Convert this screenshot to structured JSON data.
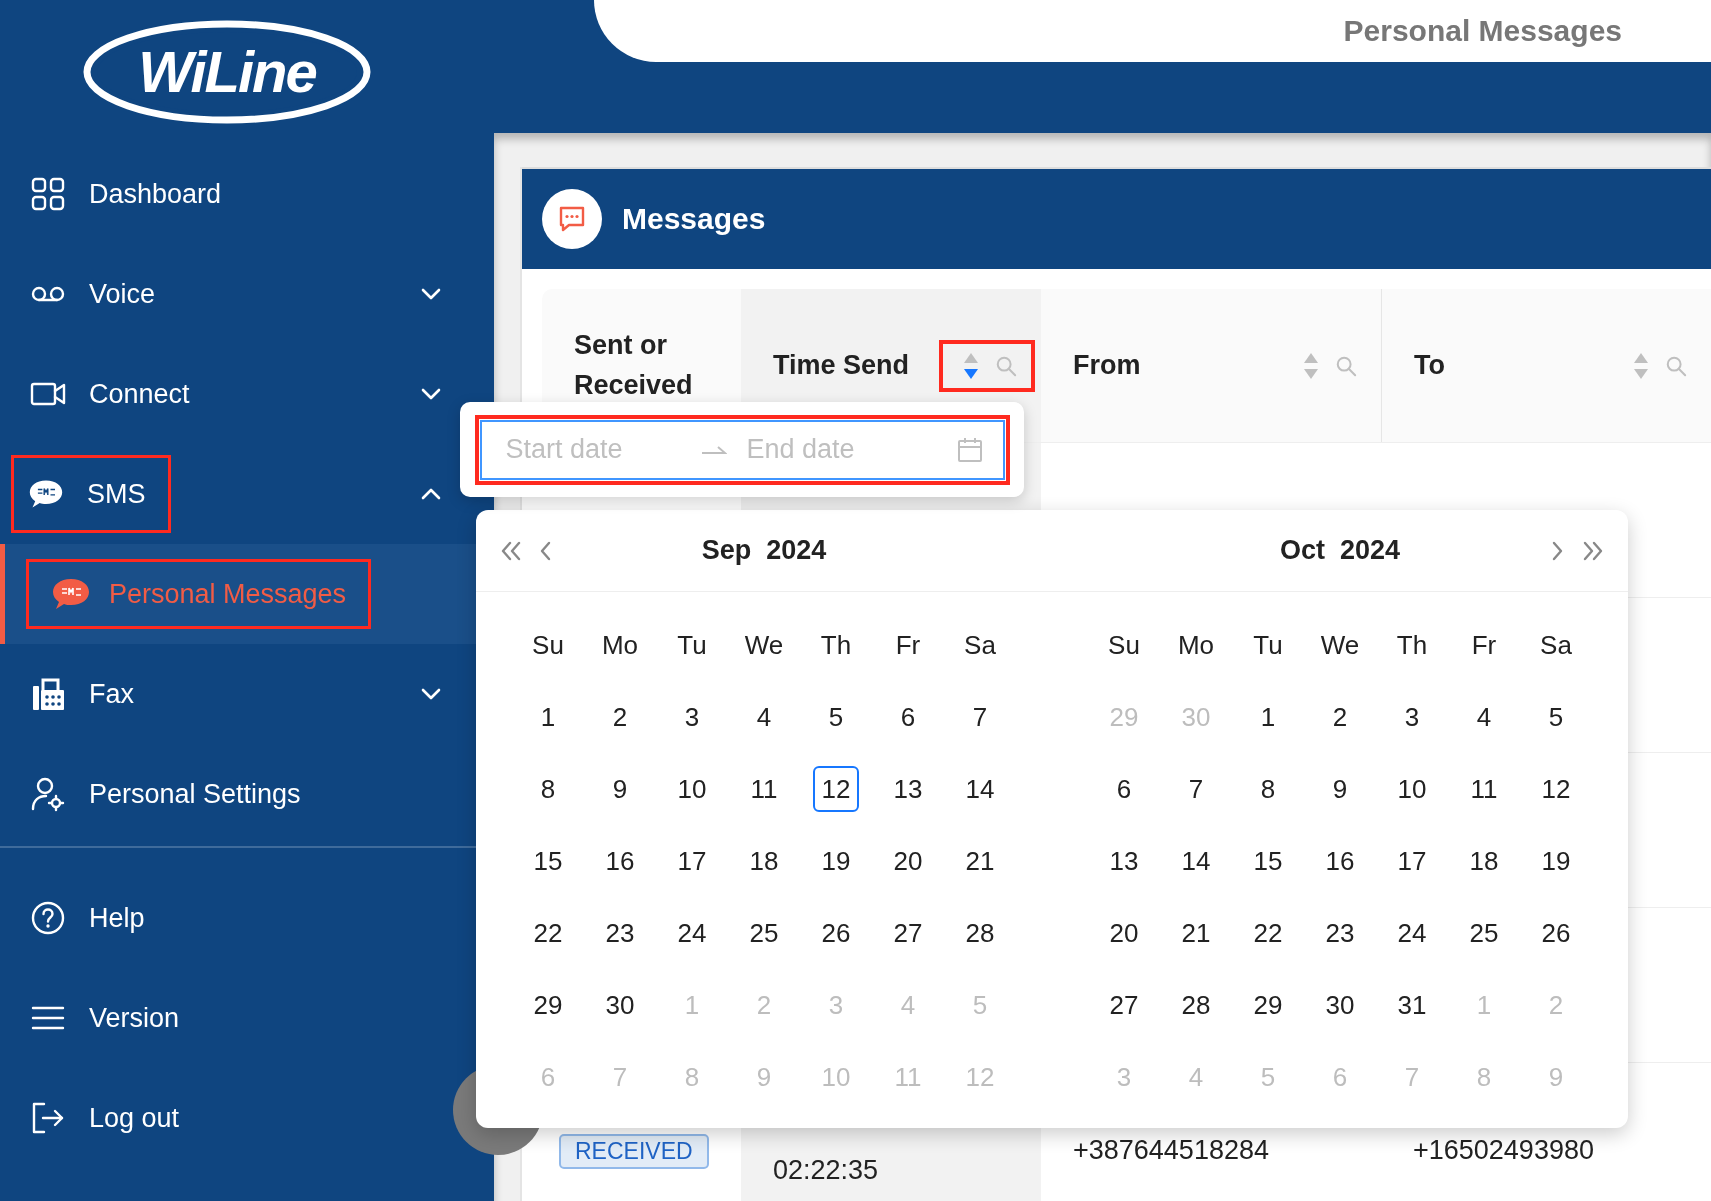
{
  "logo": "WiLine",
  "header": {
    "title": "Personal Messages"
  },
  "menu": [
    {
      "label": "Dashboard",
      "expandable": false,
      "highlighted": false
    },
    {
      "label": "Voice",
      "expandable": true,
      "expanded": false,
      "highlighted": false
    },
    {
      "label": "Connect",
      "expandable": true,
      "expanded": false,
      "highlighted": false
    },
    {
      "label": "SMS",
      "expandable": true,
      "expanded": true,
      "highlighted": true,
      "children": [
        {
          "label": "Personal Messages",
          "selected": true,
          "highlighted": true
        }
      ]
    },
    {
      "label": "Fax",
      "expandable": true,
      "expanded": false,
      "highlighted": false
    },
    {
      "label": "Personal Settings",
      "expandable": false,
      "highlighted": false
    }
  ],
  "bottom_menu": [
    {
      "label": "Help"
    },
    {
      "label": "Version"
    },
    {
      "label": "Log out"
    }
  ],
  "card": {
    "title": "Messages"
  },
  "table": {
    "columns": [
      {
        "label": "Sent or Received",
        "filterable": false,
        "sorted": false,
        "highlighted": false
      },
      {
        "label": "Time Send",
        "filterable": true,
        "sorted": true,
        "highlighted": true
      },
      {
        "label": "From",
        "filterable": true,
        "sorted": false,
        "highlighted": false
      },
      {
        "label": "To",
        "filterable": true,
        "sorted": false,
        "highlighted": false
      }
    ],
    "rows": [
      {
        "status": "RECEIVED",
        "time": "02:22:35",
        "from": "+387644518284",
        "to": "+16502493980"
      }
    ]
  },
  "date_range": {
    "start_placeholder": "Start date",
    "end_placeholder": "End date",
    "highlighted": true
  },
  "calendar": {
    "weekdays_left": [
      "Su",
      "Mo",
      "Tu",
      "We",
      "Th",
      "Fr",
      "Sa"
    ],
    "weekdays_right": [
      "Su",
      "Mo",
      "Tu",
      "We",
      "Th",
      "Fr",
      "Sa"
    ],
    "panels": [
      {
        "month": "Sep",
        "year": "2024",
        "weeks": [
          [
            {
              "t": "1",
              "kind": "normal"
            },
            {
              "t": "2",
              "kind": "normal"
            },
            {
              "t": "3",
              "kind": "normal"
            },
            {
              "t": "4",
              "kind": "normal"
            },
            {
              "t": "5",
              "kind": "normal"
            },
            {
              "t": "6",
              "kind": "normal"
            },
            {
              "t": "7",
              "kind": "normal"
            }
          ],
          [
            {
              "t": "8",
              "kind": "normal"
            },
            {
              "t": "9",
              "kind": "normal"
            },
            {
              "t": "10",
              "kind": "normal"
            },
            {
              "t": "11",
              "kind": "normal"
            },
            {
              "t": "12",
              "kind": "today"
            },
            {
              "t": "13",
              "kind": "normal"
            },
            {
              "t": "14",
              "kind": "normal"
            }
          ],
          [
            {
              "t": "15",
              "kind": "normal"
            },
            {
              "t": "16",
              "kind": "normal"
            },
            {
              "t": "17",
              "kind": "normal"
            },
            {
              "t": "18",
              "kind": "normal"
            },
            {
              "t": "19",
              "kind": "normal"
            },
            {
              "t": "20",
              "kind": "normal"
            },
            {
              "t": "21",
              "kind": "normal"
            }
          ],
          [
            {
              "t": "22",
              "kind": "normal"
            },
            {
              "t": "23",
              "kind": "normal"
            },
            {
              "t": "24",
              "kind": "normal"
            },
            {
              "t": "25",
              "kind": "normal"
            },
            {
              "t": "26",
              "kind": "normal"
            },
            {
              "t": "27",
              "kind": "normal"
            },
            {
              "t": "28",
              "kind": "normal"
            }
          ],
          [
            {
              "t": "29",
              "kind": "normal"
            },
            {
              "t": "30",
              "kind": "normal"
            },
            {
              "t": "1",
              "kind": "muted"
            },
            {
              "t": "2",
              "kind": "muted"
            },
            {
              "t": "3",
              "kind": "muted"
            },
            {
              "t": "4",
              "kind": "muted"
            },
            {
              "t": "5",
              "kind": "muted"
            }
          ],
          [
            {
              "t": "6",
              "kind": "muted"
            },
            {
              "t": "7",
              "kind": "muted"
            },
            {
              "t": "8",
              "kind": "muted"
            },
            {
              "t": "9",
              "kind": "muted"
            },
            {
              "t": "10",
              "kind": "muted"
            },
            {
              "t": "11",
              "kind": "muted"
            },
            {
              "t": "12",
              "kind": "muted"
            }
          ]
        ]
      },
      {
        "month": "Oct",
        "year": "2024",
        "weeks": [
          [
            {
              "t": "29",
              "kind": "muted"
            },
            {
              "t": "30",
              "kind": "muted"
            },
            {
              "t": "1",
              "kind": "normal"
            },
            {
              "t": "2",
              "kind": "normal"
            },
            {
              "t": "3",
              "kind": "normal"
            },
            {
              "t": "4",
              "kind": "normal"
            },
            {
              "t": "5",
              "kind": "normal"
            }
          ],
          [
            {
              "t": "6",
              "kind": "normal"
            },
            {
              "t": "7",
              "kind": "normal"
            },
            {
              "t": "8",
              "kind": "normal"
            },
            {
              "t": "9",
              "kind": "normal"
            },
            {
              "t": "10",
              "kind": "normal"
            },
            {
              "t": "11",
              "kind": "normal"
            },
            {
              "t": "12",
              "kind": "normal"
            }
          ],
          [
            {
              "t": "13",
              "kind": "normal"
            },
            {
              "t": "14",
              "kind": "normal"
            },
            {
              "t": "15",
              "kind": "normal"
            },
            {
              "t": "16",
              "kind": "normal"
            },
            {
              "t": "17",
              "kind": "normal"
            },
            {
              "t": "18",
              "kind": "normal"
            },
            {
              "t": "19",
              "kind": "normal"
            }
          ],
          [
            {
              "t": "20",
              "kind": "normal"
            },
            {
              "t": "21",
              "kind": "normal"
            },
            {
              "t": "22",
              "kind": "normal"
            },
            {
              "t": "23",
              "kind": "normal"
            },
            {
              "t": "24",
              "kind": "normal"
            },
            {
              "t": "25",
              "kind": "normal"
            },
            {
              "t": "26",
              "kind": "normal"
            }
          ],
          [
            {
              "t": "27",
              "kind": "normal"
            },
            {
              "t": "28",
              "kind": "normal"
            },
            {
              "t": "29",
              "kind": "normal"
            },
            {
              "t": "30",
              "kind": "normal"
            },
            {
              "t": "31",
              "kind": "normal"
            },
            {
              "t": "1",
              "kind": "muted"
            },
            {
              "t": "2",
              "kind": "muted"
            }
          ],
          [
            {
              "t": "3",
              "kind": "muted"
            },
            {
              "t": "4",
              "kind": "muted"
            },
            {
              "t": "5",
              "kind": "muted"
            },
            {
              "t": "6",
              "kind": "muted"
            },
            {
              "t": "7",
              "kind": "muted"
            },
            {
              "t": "8",
              "kind": "muted"
            },
            {
              "t": "9",
              "kind": "muted"
            }
          ]
        ]
      }
    ]
  }
}
